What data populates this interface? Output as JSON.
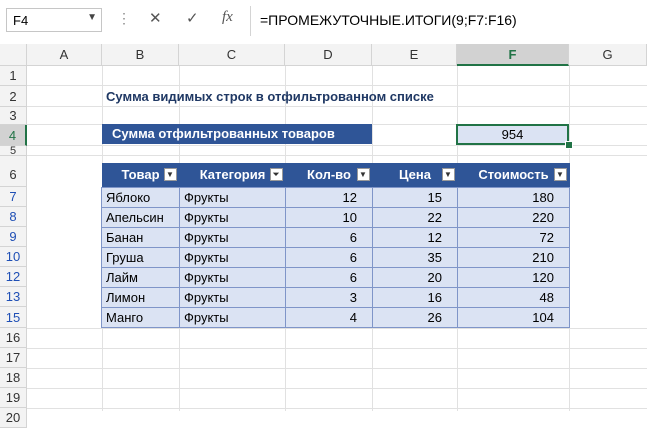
{
  "formula_bar": {
    "name_box": "F4",
    "cancel_icon": "✕",
    "confirm_icon": "✓",
    "fx_icon": "fx",
    "formula": "=ПРОМЕЖУТОЧНЫЕ.ИТОГИ(9;F7:F16)"
  },
  "columns": [
    "A",
    "B",
    "C",
    "D",
    "E",
    "F",
    "G"
  ],
  "rows": [
    "1",
    "2",
    "3",
    "4",
    "5",
    "6",
    "7",
    "8",
    "9",
    "10",
    "12",
    "13",
    "15",
    "16",
    "17",
    "18",
    "19",
    "20"
  ],
  "selected_cell": "F4",
  "title": "Сумма видимых строк в отфильтрованном списке",
  "summary": {
    "label": "Сумма отфильтрованных товаров",
    "value": "954"
  },
  "table": {
    "headers": [
      "Товар",
      "Категория",
      "Кол-во",
      "Цена",
      "Стоимость"
    ],
    "filtered_column": "Категория",
    "rows": [
      [
        "Яблоко",
        "Фрукты",
        "12",
        "15",
        "180"
      ],
      [
        "Апельсин",
        "Фрукты",
        "10",
        "22",
        "220"
      ],
      [
        "Банан",
        "Фрукты",
        "6",
        "12",
        "72"
      ],
      [
        "Груша",
        "Фрукты",
        "6",
        "35",
        "210"
      ],
      [
        "Лайм",
        "Фрукты",
        "6",
        "20",
        "120"
      ],
      [
        "Лимон",
        "Фрукты",
        "3",
        "16",
        "48"
      ],
      [
        "Манго",
        "Фрукты",
        "4",
        "26",
        "104"
      ]
    ]
  },
  "colors": {
    "header_blue": "#2f5597",
    "cell_fill": "#dbe3f3",
    "selection_green": "#217346",
    "filtered_row_number": "#1f4fb5"
  }
}
